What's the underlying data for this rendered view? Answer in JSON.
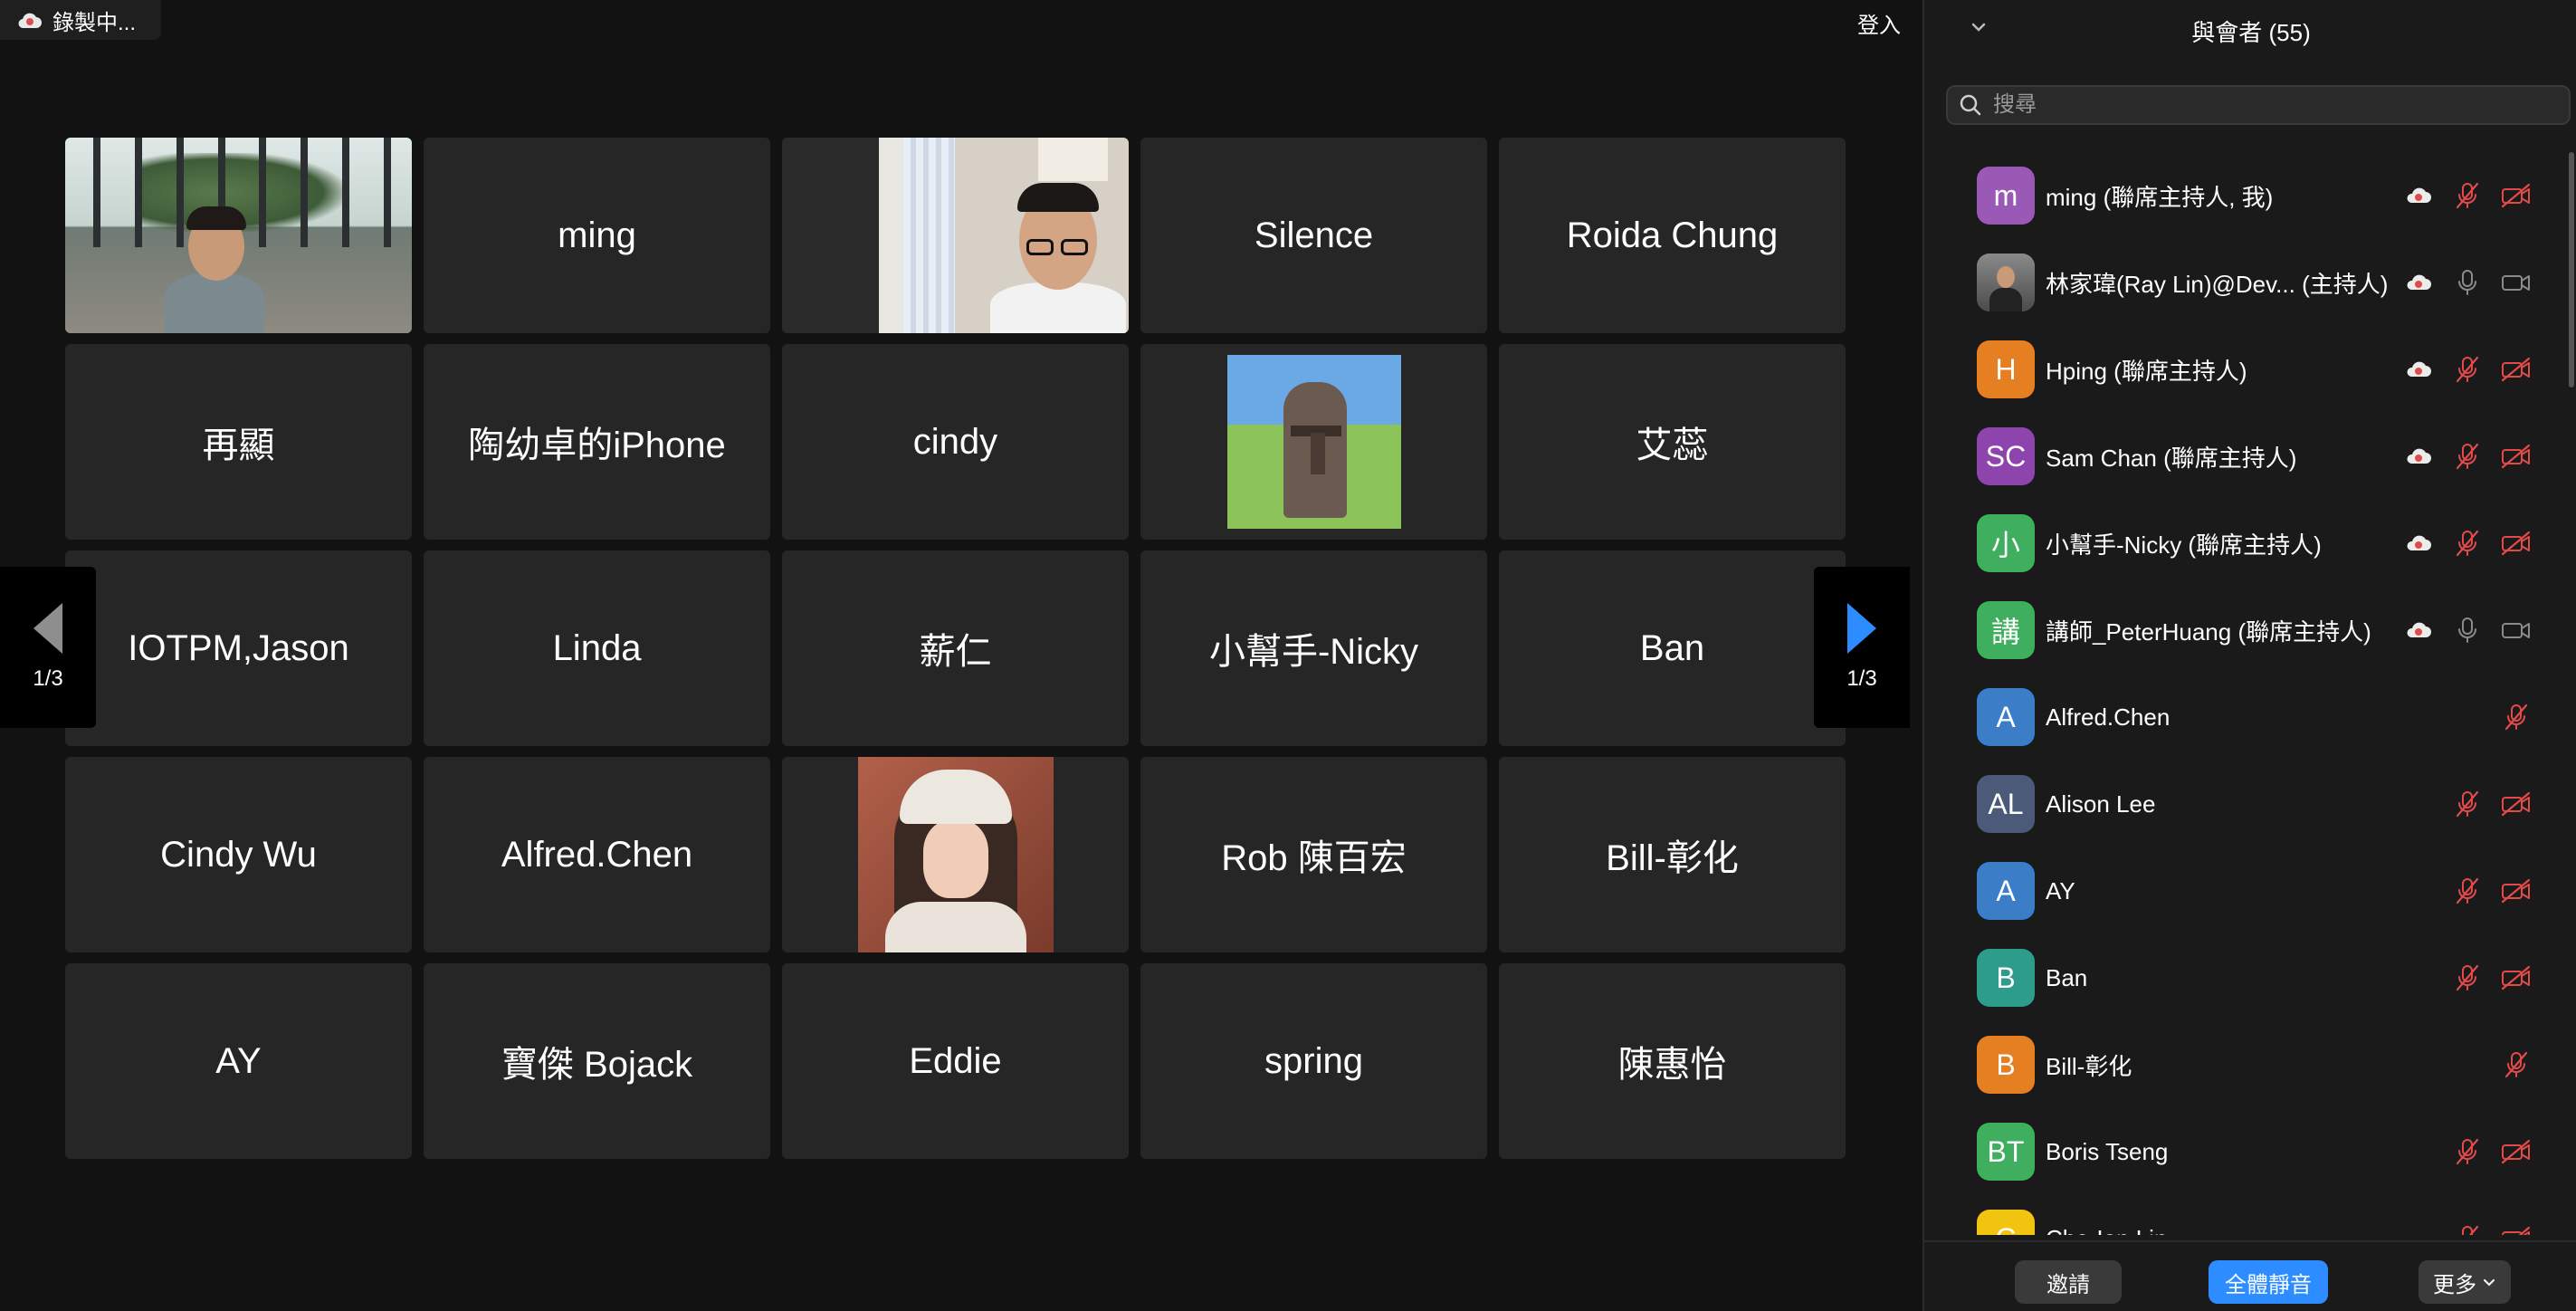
{
  "recording": {
    "label": "錄製中..."
  },
  "header": {
    "login_label": "登入"
  },
  "grid": {
    "tiles": [
      {
        "name": "",
        "type": "video-office"
      },
      {
        "name": "ming",
        "type": "name"
      },
      {
        "name": "",
        "type": "video-room"
      },
      {
        "name": "Silence",
        "type": "name"
      },
      {
        "name": "Roida Chung",
        "type": "name"
      },
      {
        "name": "再顯",
        "type": "name"
      },
      {
        "name": "陶幼卓的iPhone",
        "type": "name"
      },
      {
        "name": "cindy",
        "type": "name"
      },
      {
        "name": "",
        "type": "avatar-moai"
      },
      {
        "name": "艾蕊",
        "type": "name"
      },
      {
        "name": "IOTPM,Jason",
        "type": "name"
      },
      {
        "name": "Linda",
        "type": "name"
      },
      {
        "name": "薪仁",
        "type": "name"
      },
      {
        "name": "小幫手-Nicky",
        "type": "name"
      },
      {
        "name": "Ban",
        "type": "name"
      },
      {
        "name": "Cindy Wu",
        "type": "name"
      },
      {
        "name": "Alfred.Chen",
        "type": "name"
      },
      {
        "name": "",
        "type": "avatar-woman"
      },
      {
        "name": "Rob 陳百宏",
        "type": "name"
      },
      {
        "name": "Bill-彰化",
        "type": "name"
      },
      {
        "name": "AY",
        "type": "name"
      },
      {
        "name": "寶傑 Bojack",
        "type": "name"
      },
      {
        "name": "Eddie",
        "type": "name"
      },
      {
        "name": "spring",
        "type": "name"
      },
      {
        "name": "陳惠怡",
        "type": "name"
      }
    ]
  },
  "pager": {
    "left_count": "1/3",
    "right_count": "1/3"
  },
  "panel": {
    "title": "與會者 (55)",
    "search_placeholder": "搜尋",
    "participants": [
      {
        "avatar_text": "m",
        "color": "#9b59b6",
        "name": "ming (聯席主持人, 我)",
        "cloud": true,
        "mic": "muted",
        "cam": "off"
      },
      {
        "avatar_text": "",
        "color": "#6d6d6d",
        "photo": true,
        "name": "林家瑋(Ray Lin)@Dev... (主持人)",
        "cloud": true,
        "mic": "on",
        "cam": "on"
      },
      {
        "avatar_text": "H",
        "color": "#e67e22",
        "name": "Hping (聯席主持人)",
        "cloud": true,
        "mic": "muted",
        "cam": "off"
      },
      {
        "avatar_text": "SC",
        "color": "#8e44ad",
        "name": "Sam Chan (聯席主持人)",
        "cloud": true,
        "mic": "muted",
        "cam": "off"
      },
      {
        "avatar_text": "小",
        "color": "#3fae5e",
        "name": "小幫手-Nicky (聯席主持人)",
        "cloud": true,
        "mic": "muted",
        "cam": "off"
      },
      {
        "avatar_text": "講",
        "color": "#3fae5e",
        "name": "講師_PeterHuang (聯席主持人)",
        "cloud": true,
        "mic": "on",
        "cam": "on"
      },
      {
        "avatar_text": "A",
        "color": "#3b7dc6",
        "name": "Alfred.Chen",
        "cloud": false,
        "mic": "none",
        "cam": "off"
      },
      {
        "avatar_text": "AL",
        "color": "#4a5a78",
        "name": "Alison Lee",
        "cloud": false,
        "mic": "muted",
        "cam": "off"
      },
      {
        "avatar_text": "A",
        "color": "#3b7dc6",
        "name": "AY",
        "cloud": false,
        "mic": "muted",
        "cam": "off"
      },
      {
        "avatar_text": "B",
        "color": "#2e9c8a",
        "name": "Ban",
        "cloud": false,
        "mic": "muted",
        "cam": "off"
      },
      {
        "avatar_text": "B",
        "color": "#e67e22",
        "name": "Bill-彰化",
        "cloud": false,
        "mic": "none",
        "cam": "off"
      },
      {
        "avatar_text": "BT",
        "color": "#3fae5e",
        "name": "Boris Tseng",
        "cloud": false,
        "mic": "muted",
        "cam": "off"
      },
      {
        "avatar_text": "C",
        "color": "#f1c40f",
        "name": "Che-Ien Lin",
        "cloud": false,
        "mic": "muted",
        "cam": "off"
      }
    ]
  },
  "footer": {
    "invite": "邀請",
    "mute_all": "全體靜音",
    "more": "更多"
  },
  "colors": {
    "accent": "#2d8cff",
    "muted_red": "#e24b4b",
    "active_green": "#2ec866"
  }
}
